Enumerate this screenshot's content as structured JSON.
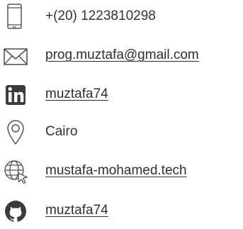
{
  "contact": {
    "phone": {
      "icon": "phone-icon",
      "text": "+(20) 1223810298"
    },
    "email": {
      "icon": "envelope-icon",
      "text": "prog.muztafa@gmail.com"
    },
    "linkedin": {
      "icon": "linkedin-icon",
      "text": "muztafa74"
    },
    "location": {
      "icon": "map-pin-icon",
      "text": "Cairo"
    },
    "website": {
      "icon": "globe-cursor-icon",
      "text": "mustafa-mohamed.tech"
    },
    "github": {
      "icon": "github-icon",
      "text": "muztafa74"
    }
  },
  "colors": {
    "text": "#333333",
    "icon": "#555555"
  }
}
